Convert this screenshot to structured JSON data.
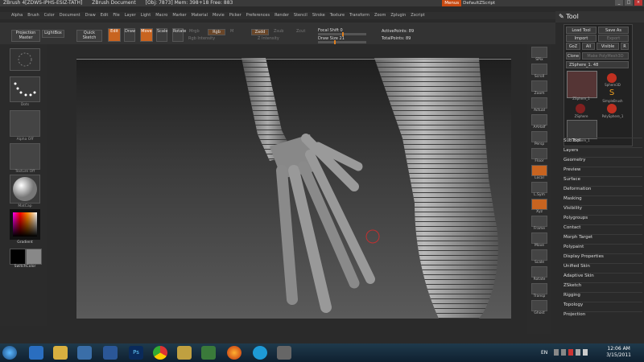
{
  "titlebar": {
    "app": "ZBrush 4[ZDWS-IPHS-ESIZ-TATH]",
    "doc": "ZBrush Document",
    "stats": "[Obj: 7873]  Mem: 398+18  Free: 883",
    "menus_btn": "Menus",
    "script": "DefaultZScript",
    "min": "_",
    "max": "□",
    "close": "×"
  },
  "menubar": {
    "items": [
      "Alpha",
      "Brush",
      "Color",
      "Document",
      "Draw",
      "Edit",
      "File",
      "Layer",
      "Light",
      "Macro",
      "Marker",
      "Material",
      "Movie",
      "Picker",
      "Preferences",
      "Render",
      "Stencil",
      "Stroke",
      "Texture",
      "Transform",
      "Zoom",
      "Zplugin",
      "Zscript"
    ]
  },
  "toolbar": {
    "projection_master": "Projection Master",
    "lightbox": "LightBox",
    "quick_sketch": "Quick Sketch",
    "edit": "Edit",
    "draw": "Draw",
    "move": "Move",
    "scale": "Scale",
    "rotate": "Rotate",
    "mrgb": "Mrgb",
    "rgb": "Rgb",
    "m": "M",
    "zadd": "Zadd",
    "zsub": "Zsub",
    "zcut": "Zcut",
    "rgb_intensity": "Rgb Intensity",
    "z_intensity": "Z Intensity",
    "focal_shift_label": "Focal Shift",
    "focal_shift_value": "0",
    "draw_size_label": "Draw Size",
    "draw_size_value": "21",
    "active_points": "ActivePoints: 89",
    "total_points": "TotalPoints: 89"
  },
  "leftshelf": {
    "dots_label": "Dots",
    "alpha_label": "Alpha Off",
    "texture_label": "Texture Off",
    "material_label": "MatCap",
    "gradient_label": "Gradient",
    "switchcolor_label": "SwitchColor"
  },
  "rightshelf": {
    "items": [
      "SPix",
      "Scroll",
      "Zoom",
      "Actual",
      "AAHalf",
      "Persp",
      "Floor",
      "Local",
      "L.Sym",
      "Xyz",
      "Frame",
      "Move",
      "Scale",
      "Rotate",
      "Transp",
      "Ghost"
    ]
  },
  "toolpanel": {
    "title": "Tool",
    "load_tool": "Load Tool",
    "save_as": "Save As",
    "import": "Import",
    "export": "Export",
    "goz": "GoZ",
    "all": "All",
    "visible": "Visible",
    "r": "R",
    "clone": "Clone",
    "make_polymesh": "Make PolyMesh3D",
    "current_tool": "ZSphere_1. 48",
    "thumbs": [
      "ZSphere_1",
      "Sphere3D",
      "SimpleBrush",
      "ZSphere",
      "PolySphere_1",
      "ZSphere_1"
    ],
    "menu_items": [
      "SubTool",
      "Layers",
      "Geometry",
      "Preview",
      "Surface",
      "Deformation",
      "Masking",
      "Visibility",
      "Polygroups",
      "Contact",
      "Morph Target",
      "Polypaint",
      "Display Properties",
      "Unified Skin",
      "Adaptive Skin",
      "ZSketch",
      "Rigging",
      "Topology",
      "Projection"
    ]
  },
  "taskbar": {
    "lang": "EN",
    "time": "12:06 AM",
    "date": "3/15/2011"
  },
  "colors": {
    "accent": "#c86420",
    "panel": "#2a2a2a"
  }
}
